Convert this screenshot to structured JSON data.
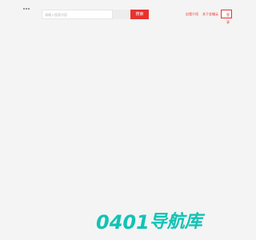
{
  "header": {
    "brand_icon": "three-dot-logo-icon",
    "search": {
      "placeholder": "请输入搜索内容",
      "value": "",
      "button_label": "搜索"
    },
    "links": [
      {
        "label": "自我介绍"
      },
      {
        "label": "关于金蝶云"
      }
    ],
    "login_label": "登录"
  },
  "footer": {
    "logo_digits": "0401",
    "logo_name": "导航库"
  },
  "colors": {
    "accent": "#e8322f",
    "logo": "#11c3b5",
    "background": "#f4f4f4"
  }
}
